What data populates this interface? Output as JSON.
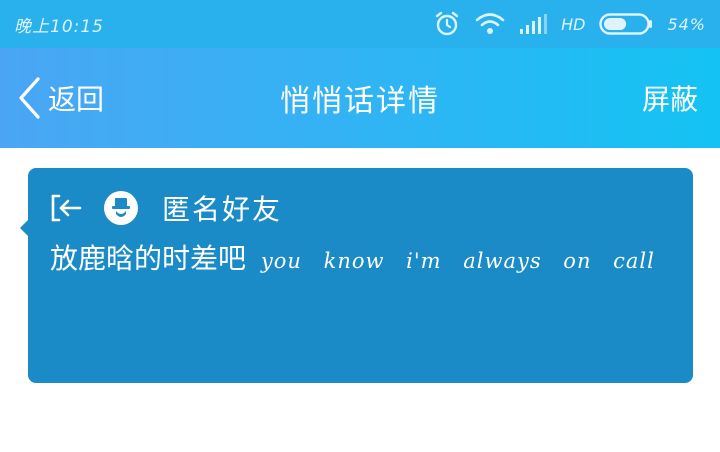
{
  "status_bar": {
    "time": "晚上10:15",
    "network": "HD",
    "battery_percent": "54%",
    "battery_level": 0.54,
    "icons": [
      "alarm-icon",
      "wifi-icon",
      "signal-icon",
      "battery-icon"
    ]
  },
  "nav": {
    "back_label": "返回",
    "title": "悄悄话详情",
    "action_label": "屏蔽"
  },
  "message": {
    "sender": "匿名好友",
    "text_cjk": "放鹿晗的时差吧",
    "text_latin": "you know i'm always on call"
  },
  "colors": {
    "status_bar": "#29b1ee",
    "nav_start": "#4aa6f4",
    "nav_end": "#14c3f3",
    "card": "#1b8bc7"
  }
}
